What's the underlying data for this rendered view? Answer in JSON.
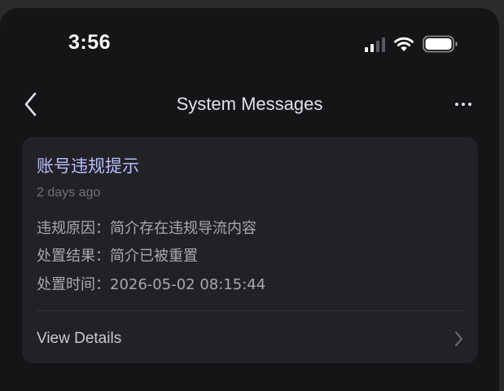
{
  "status_bar": {
    "time": "3:56",
    "icons": [
      "cellular-signal-icon",
      "wifi-icon",
      "battery-icon"
    ]
  },
  "nav": {
    "title": "System Messages",
    "back_icon": "chevron-left-icon",
    "more_icon": "more-horizontal-icon"
  },
  "message": {
    "title": "账号违规提示",
    "time_ago": "2 days ago",
    "reason": "违规原因：简介存在违规导流内容",
    "result": "处置结果：简介已被重置",
    "handled_at": "处置时间：2026-05-02 08:15:44",
    "details_label": "View Details",
    "details_icon": "chevron-right-icon"
  },
  "colors": {
    "background": "#151518",
    "card": "#222226",
    "title_accent": "#b8bcff",
    "body_text": "#a7a7ad",
    "muted_text": "#6e6e74"
  }
}
